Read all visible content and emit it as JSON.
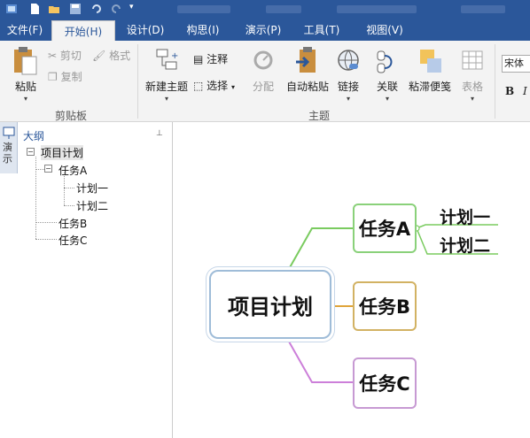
{
  "tabs": {
    "file": "文件(F)",
    "home": "开始(H)",
    "design": "设计(D)",
    "structure": "构思(I)",
    "present": "演示(P)",
    "tools": "工具(T)",
    "view": "视图(V)"
  },
  "clipboard": {
    "paste": "粘贴",
    "cut": "剪切",
    "copy": "复制",
    "format": "格式",
    "group_label": "剪贴板"
  },
  "topic_group": {
    "new_topic": "新建主题",
    "note": "注释",
    "select": "选择",
    "split": "分配",
    "auto_paste": "自动粘贴",
    "link": "链接",
    "relation": "关联",
    "sticky_note": "粘滞便笺",
    "table": "表格",
    "group_label": "主题"
  },
  "font": {
    "name": "宋体",
    "bold": "B",
    "italic": "I"
  },
  "outline_panel": {
    "vertical_tab": "演示",
    "title": "大纲",
    "pin": "📌"
  },
  "tree": {
    "root": "项目计划",
    "task_a": "任务A",
    "plan_1": "计划一",
    "plan_2": "计划二",
    "task_b": "任务B",
    "task_c": "任务C"
  },
  "mindmap": {
    "central": "项目计划",
    "topics": [
      "任务A",
      "任务B",
      "任务C"
    ],
    "subtopics": [
      "计划一",
      "计划二"
    ],
    "colors": {
      "branch_a": "#7acb5f",
      "branch_b": "#e0a43a",
      "branch_c": "#cc7fd9",
      "central_border": "#9fbcd8"
    }
  },
  "colors": {
    "accent": "#2b579a",
    "ribbon_bg": "#f3f3f3"
  }
}
